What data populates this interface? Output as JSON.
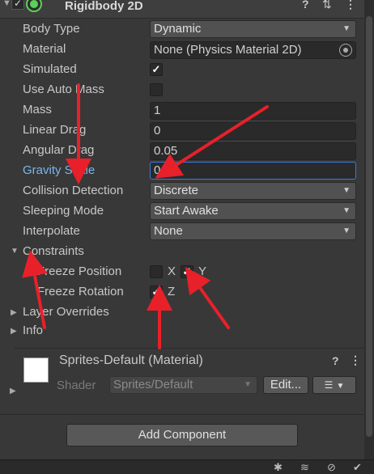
{
  "component": {
    "title": "Rigidbody 2D",
    "enabled_mark": "✓",
    "icons": [
      "help-icon",
      "preset-icon",
      "context-menu-icon"
    ]
  },
  "properties": {
    "body_type": {
      "label": "Body Type",
      "value": "Dynamic"
    },
    "material": {
      "label": "Material",
      "value": "None (Physics Material 2D)"
    },
    "simulated": {
      "label": "Simulated",
      "checked": "✓"
    },
    "use_auto_mass": {
      "label": "Use Auto Mass"
    },
    "mass": {
      "label": "Mass",
      "value": "1"
    },
    "linear_drag": {
      "label": "Linear Drag",
      "value": "0"
    },
    "angular_drag": {
      "label": "Angular Drag",
      "value": "0.05"
    },
    "gravity_scale": {
      "label": "Gravity Scale",
      "value": "0"
    },
    "collision_detection": {
      "label": "Collision Detection",
      "value": "Discrete"
    },
    "sleeping_mode": {
      "label": "Sleeping Mode",
      "value": "Start Awake"
    },
    "interpolate": {
      "label": "Interpolate",
      "value": "None"
    }
  },
  "constraints": {
    "label": "Constraints",
    "freeze_position": {
      "label": "Freeze Position",
      "x_label": "X",
      "y_label": "Y",
      "y_checked": "✓"
    },
    "freeze_rotation": {
      "label": "Freeze Rotation",
      "z_label": "Z",
      "z_checked": "✓"
    }
  },
  "foldouts": {
    "layer_overrides": "Layer Overrides",
    "info": "Info"
  },
  "material_section": {
    "title": "Sprites-Default (Material)",
    "shader_label": "Shader",
    "shader_value": "Sprites/Default",
    "edit_button": "Edit..."
  },
  "add_component": "Add Component",
  "colors": {
    "annotation_arrow": "#e8202a",
    "focus_border": "#3b7ad6",
    "active_label": "#7ab6f0"
  }
}
